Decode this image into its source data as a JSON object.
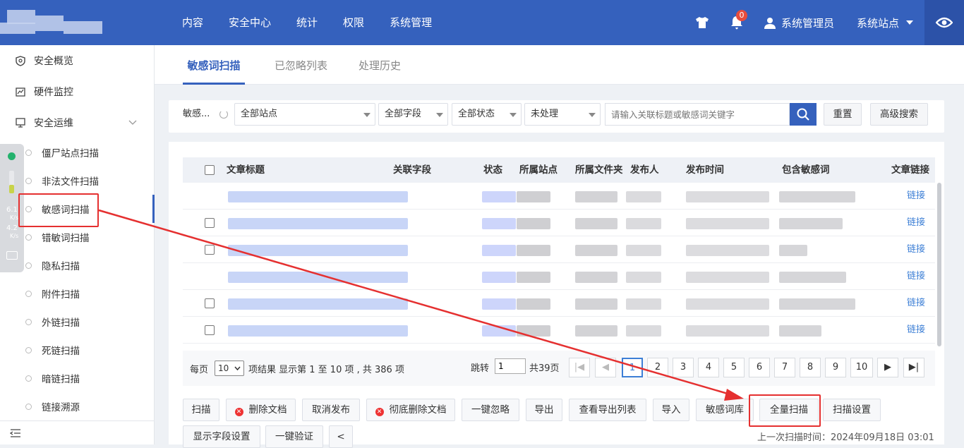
{
  "topnav": {
    "items": [
      "内容",
      "安全中心",
      "统计",
      "权限",
      "系统管理"
    ],
    "notif_count": "0",
    "user": "系统管理员",
    "site": "系统站点"
  },
  "sidebar": {
    "groups": [
      "安全概览",
      "硬件监控",
      "安全运维"
    ],
    "items": [
      "僵尸站点扫描",
      "非法文件扫描",
      "敏感词扫描",
      "错敏词扫描",
      "隐私扫描",
      "附件扫描",
      "外链扫描",
      "死链扫描",
      "暗链扫描",
      "链接溯源"
    ],
    "float_up": "6.1",
    "float_up_unit": "K/s",
    "float_down": "4.2",
    "float_down_unit": "K/s"
  },
  "tabs": [
    "敏感词扫描",
    "已忽略列表",
    "处理历史"
  ],
  "filter": {
    "name": "敏感...",
    "site": "全部站点",
    "field": "全部字段",
    "status": "全部状态",
    "handled": "未处理",
    "search_placeholder": "请输入关联标题或敏感词关键字",
    "reset": "重置",
    "advanced": "高级搜索"
  },
  "table": {
    "columns": [
      "文章标题",
      "关联字段",
      "状态",
      "所属站点",
      "所属文件夹",
      "发布人",
      "发布时间",
      "包含敏感词",
      "文章链接"
    ],
    "link_label": "链接",
    "rows": [
      {
        "link": "链接"
      },
      {
        "link": "链接"
      },
      {
        "link": "链接"
      },
      {
        "link": "链接"
      },
      {
        "link": "链接"
      },
      {
        "link": "链接"
      }
    ]
  },
  "pager": {
    "per_page_label": "每页",
    "per_page": "10",
    "result_text": "项结果 显示第 1 至 10 项 , 共 386 项",
    "jump_label": "跳转",
    "jump_value": "1",
    "total_pages": "共39页",
    "pages": [
      "1",
      "2",
      "3",
      "4",
      "5",
      "6",
      "7",
      "8",
      "9",
      "10"
    ],
    "current": "1"
  },
  "actions": {
    "row1": [
      "扫描",
      "删除文档",
      "取消发布",
      "彻底删除文档",
      "一键忽略",
      "导出",
      "查看导出列表",
      "导入",
      "敏感词库",
      "全量扫描",
      "扫描设置"
    ],
    "row2": [
      "显示字段设置",
      "一键验证",
      "<"
    ],
    "last_scan": "上一次扫描时间：2024年09月18日 03:01"
  },
  "colors": {
    "primary": "#3561bd",
    "link": "#3d7fd6",
    "annotation": "#e53030"
  }
}
